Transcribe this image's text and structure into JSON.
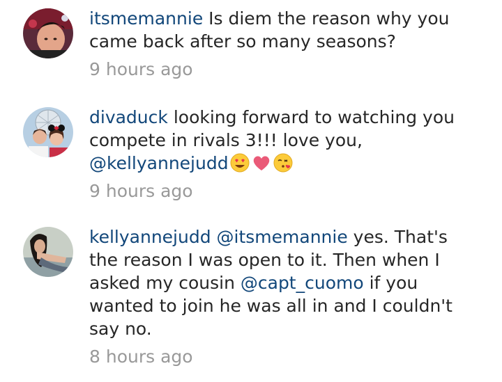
{
  "comments": [
    {
      "username": "itsmemannie",
      "text": " Is diem the reason why you came back after so many seasons?",
      "time": "9 hours ago"
    },
    {
      "username": "divaduck",
      "text": " looking forward to watching you compete in rivals 3!!! love you, ",
      "mention": "@kellyannejudd",
      "emojis": [
        "heart-eyes-emoji",
        "heart-emoji",
        "kissing-heart-emoji"
      ],
      "time": "9 hours ago"
    },
    {
      "username": "kellyannejudd",
      "mention1": "@itsmemannie",
      "text1": " yes. That's the reason I was open to it.  Then when I asked my cousin ",
      "mention2": "@capt_cuomo",
      "text2": " if you wanted to join he was all in and I couldn't say no.",
      "time": "8 hours ago"
    }
  ],
  "colors": {
    "username": "#12477a",
    "text": "#262626",
    "time": "#999999"
  }
}
